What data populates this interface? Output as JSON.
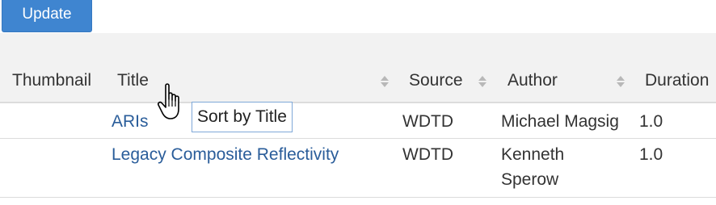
{
  "toolbar": {
    "update_label": "Update"
  },
  "table": {
    "columns": [
      {
        "label": "Thumbnail",
        "sortable": false
      },
      {
        "label": "Title",
        "sortable": true
      },
      {
        "label": "Source",
        "sortable": true
      },
      {
        "label": "Author",
        "sortable": true
      },
      {
        "label": "Duration",
        "sortable": false
      }
    ],
    "rows": [
      {
        "thumbnail": "",
        "title": "ARIs",
        "source": "WDTD",
        "author_line1": "Michael Magsig",
        "author_line2": "",
        "duration": "1.0"
      },
      {
        "thumbnail": "",
        "title": "Legacy Composite Reflectivity",
        "source": "WDTD",
        "author_line1": "Kenneth",
        "author_line2": "Sperow",
        "duration": "1.0"
      }
    ]
  },
  "tooltip": {
    "text": "Sort by Title"
  },
  "icons": {
    "sort": "sort-updown-icon",
    "cursor": "hand-pointer-icon"
  },
  "colors": {
    "button_bg": "#3f85d0",
    "link": "#2a5d9a",
    "header_bg": "#f2f2f2",
    "tooltip_border": "#7fa8d8"
  }
}
